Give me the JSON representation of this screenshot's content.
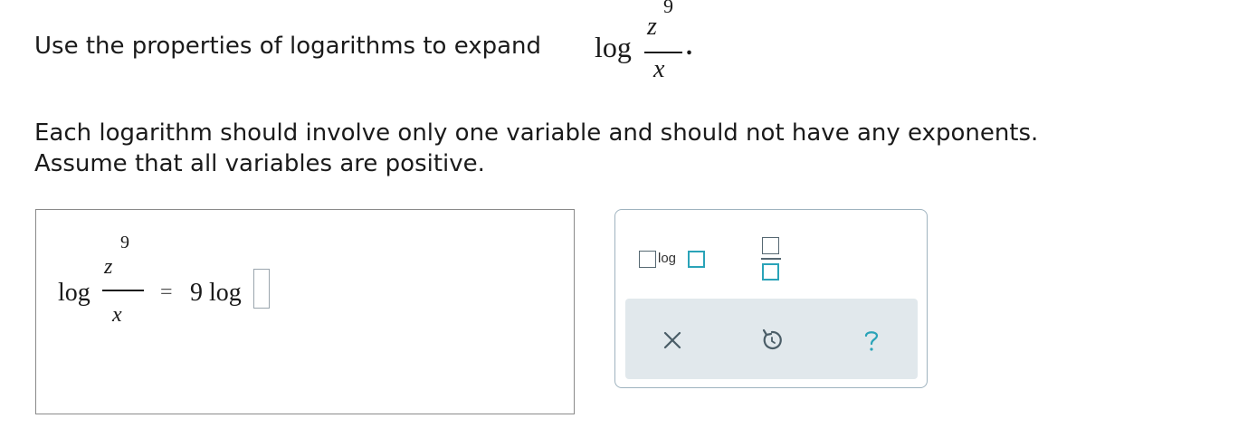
{
  "question": {
    "instruction": "Use the properties of logarithms to expand",
    "log_word": "log",
    "numerator_base": "z",
    "numerator_exp": "9",
    "denominator": "x",
    "end_punct": ".",
    "note_line1": "Each logarithm should involve only one variable and should not have any exponents.",
    "note_line2": "Assume that all variables are positive."
  },
  "answer": {
    "log_word": "log",
    "numerator_base": "z",
    "numerator_exp": "9",
    "denominator": "x",
    "equals": "=",
    "coefficient": "9",
    "log_word2": "log"
  },
  "palette": {
    "log_template_label": "log",
    "accent": "#2aa3b8",
    "action_bar_bg": "#e1e8ec",
    "actions": [
      {
        "name": "clear",
        "icon": "close-icon"
      },
      {
        "name": "undo",
        "icon": "undo-icon"
      },
      {
        "name": "help",
        "icon": "help-icon"
      }
    ]
  }
}
